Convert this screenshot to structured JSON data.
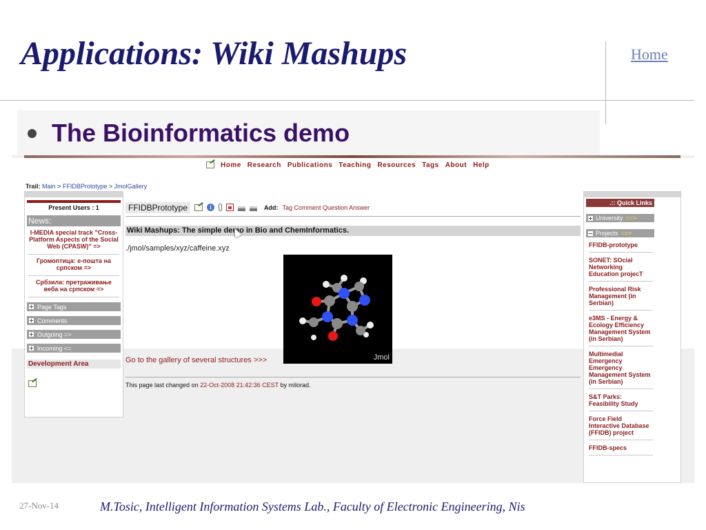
{
  "slide": {
    "title": "Applications: Wiki Mashups",
    "home_link": "Home",
    "bullet": "The Bioinformatics demo",
    "footer_date": "27-Nov-14",
    "footer_text": "M.Tosic, Intelligent Information Systems Lab., Faculty of Electronic Engineering, Nis"
  },
  "wiki": {
    "nav": [
      "Home",
      "Research",
      "Publications",
      "Teaching",
      "Resources",
      "Tags",
      "About",
      "Help"
    ],
    "trail": {
      "label": "Trail:",
      "items": [
        "Main",
        "FFIDBPrototype",
        "JmolGallery"
      ],
      "separator": ">"
    },
    "left": {
      "present_users": "Present Users : 1",
      "news_heading": "News:",
      "news": [
        "I-MEDIA special track \"Cross-Platform Aspects of the Social Web (CPASW)\" =>",
        "Громоптица: е-пошта на српском =>",
        "Србзила: претраживање веба на српском =>"
      ],
      "sections": [
        "Page Tags",
        "Comments",
        "Outgoing =>",
        "Incoming <="
      ],
      "dev_area": "Development Area"
    },
    "main": {
      "page_name": "FFIDBPrototype",
      "add_label": "Add:",
      "add_links": "Tag Comment Question Answer",
      "headline": "Wiki Mashups: The simple demo in Bio and ChemInformatics.",
      "path": "./jmol/samples/xyz/caffeine.xyz",
      "jmol_label": "Jmol",
      "gallery_link": "Go to the gallery of several structures >>>",
      "changed_prefix": "This page last changed on",
      "changed_date": "22-Oct-2008 21:42:36 CEST",
      "changed_suffix": "by milorad."
    },
    "right": {
      "quick_links": ".:: Quick Links",
      "university": "University",
      "university_arrow": "==>",
      "projects": "Projects",
      "projects_arrow": "==>",
      "items": [
        "FFIDB-prototype",
        "SONET: SOcial Networking Education projecT",
        "Professional Risk Management (in Serbian)",
        "e3MS - Energy & Ecology Efficiency Management System (in Serbian)",
        "Multimedial Emergency Emergency Management System (in Serbian)",
        "S&T Parks: Feasibility Study",
        "Force Field Interactive Database (FFIDB) project",
        "FFIDB-specs"
      ]
    }
  },
  "colors": {
    "title": "#1a1a6e",
    "bullet": "#3a1166",
    "wiki_link": "#8b1a1a",
    "home_link": "#6c7fb5"
  }
}
